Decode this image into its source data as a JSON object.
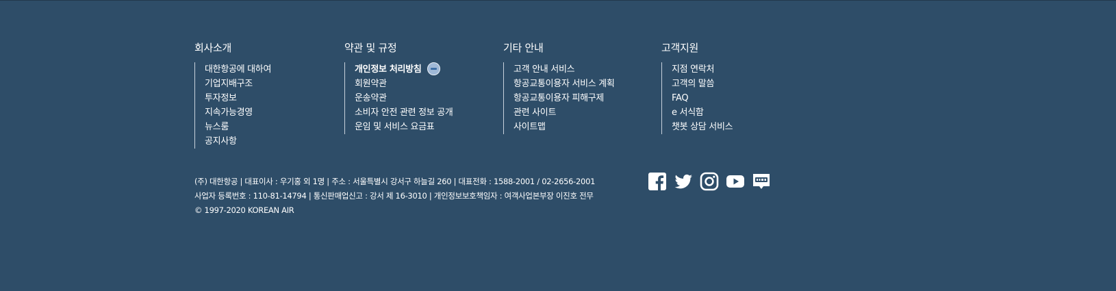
{
  "footer": {
    "columns": [
      {
        "title": "회사소개",
        "items": [
          "대한항공에 대하여",
          "기업지배구조",
          "투자정보",
          "지속가능경영",
          "뉴스룸",
          "공지사항"
        ]
      },
      {
        "title": "약관 및 규정",
        "items": [
          "개인정보 처리방침",
          "회원약관",
          "운송약관",
          "소비자 안전 관련 정보 공개",
          "운임 및 서비스 요금표"
        ]
      },
      {
        "title": "기타 안내",
        "items": [
          "고객 안내 서비스",
          "항공교통이용자 서비스 계획",
          "항공교통이용자 피해구제",
          "관련 사이트",
          "사이트맵"
        ]
      },
      {
        "title": "고객지원",
        "items": [
          "지점 연락처",
          "고객의 말씀",
          "FAQ",
          "e 서식함",
          "챗봇 상담 서비스"
        ]
      }
    ],
    "company": {
      "line1": "(주) 대한항공 | 대표이사 : 우기홍 외 1명 | 주소 : 서울특별시 강서구 하늘길 260 | 대표전화 : 1588-2001 / 02-2656-2001",
      "line2": "사업자 등록번호 : 110-81-14794 | 통신판매업신고 : 강서 제 16-3010 | 개인정보보호책임자 : 여객사업본부장 이진호 전무",
      "copyright": "© 1997-2020 KOREAN AIR"
    },
    "social": [
      "facebook-icon",
      "twitter-icon",
      "instagram-icon",
      "youtube-icon",
      "blog-icon"
    ],
    "colors": {
      "background": "#2e4d68",
      "text": "#ffffff",
      "divider": "#c9d3dd"
    }
  }
}
